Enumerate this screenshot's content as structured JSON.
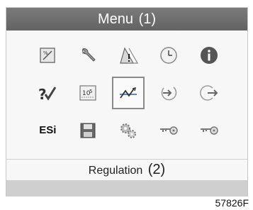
{
  "header": {
    "title": "Menu",
    "callout": "(1)"
  },
  "menu_icons": [
    [
      "scale-icon",
      "wrench-icon",
      "warning-icon",
      "clock-icon",
      "info-icon"
    ],
    [
      "check-icon",
      "counters-icon",
      "regulation-icon",
      "enter-icon",
      "exit-icon"
    ],
    [
      "esi-icon",
      "save-icon",
      "gears-icon",
      "key-icon",
      "key-icon"
    ]
  ],
  "menu_text": {
    "esi": "ESi"
  },
  "selected": {
    "row": 1,
    "col": 2
  },
  "status": {
    "label": "Regulation",
    "callout": "(2)"
  },
  "figure_id": "57826F",
  "colors": {
    "title_bar": "#6e6e6e",
    "accent_blue": "#3a5aa8",
    "bottom_bar": "#cfcfcf"
  }
}
